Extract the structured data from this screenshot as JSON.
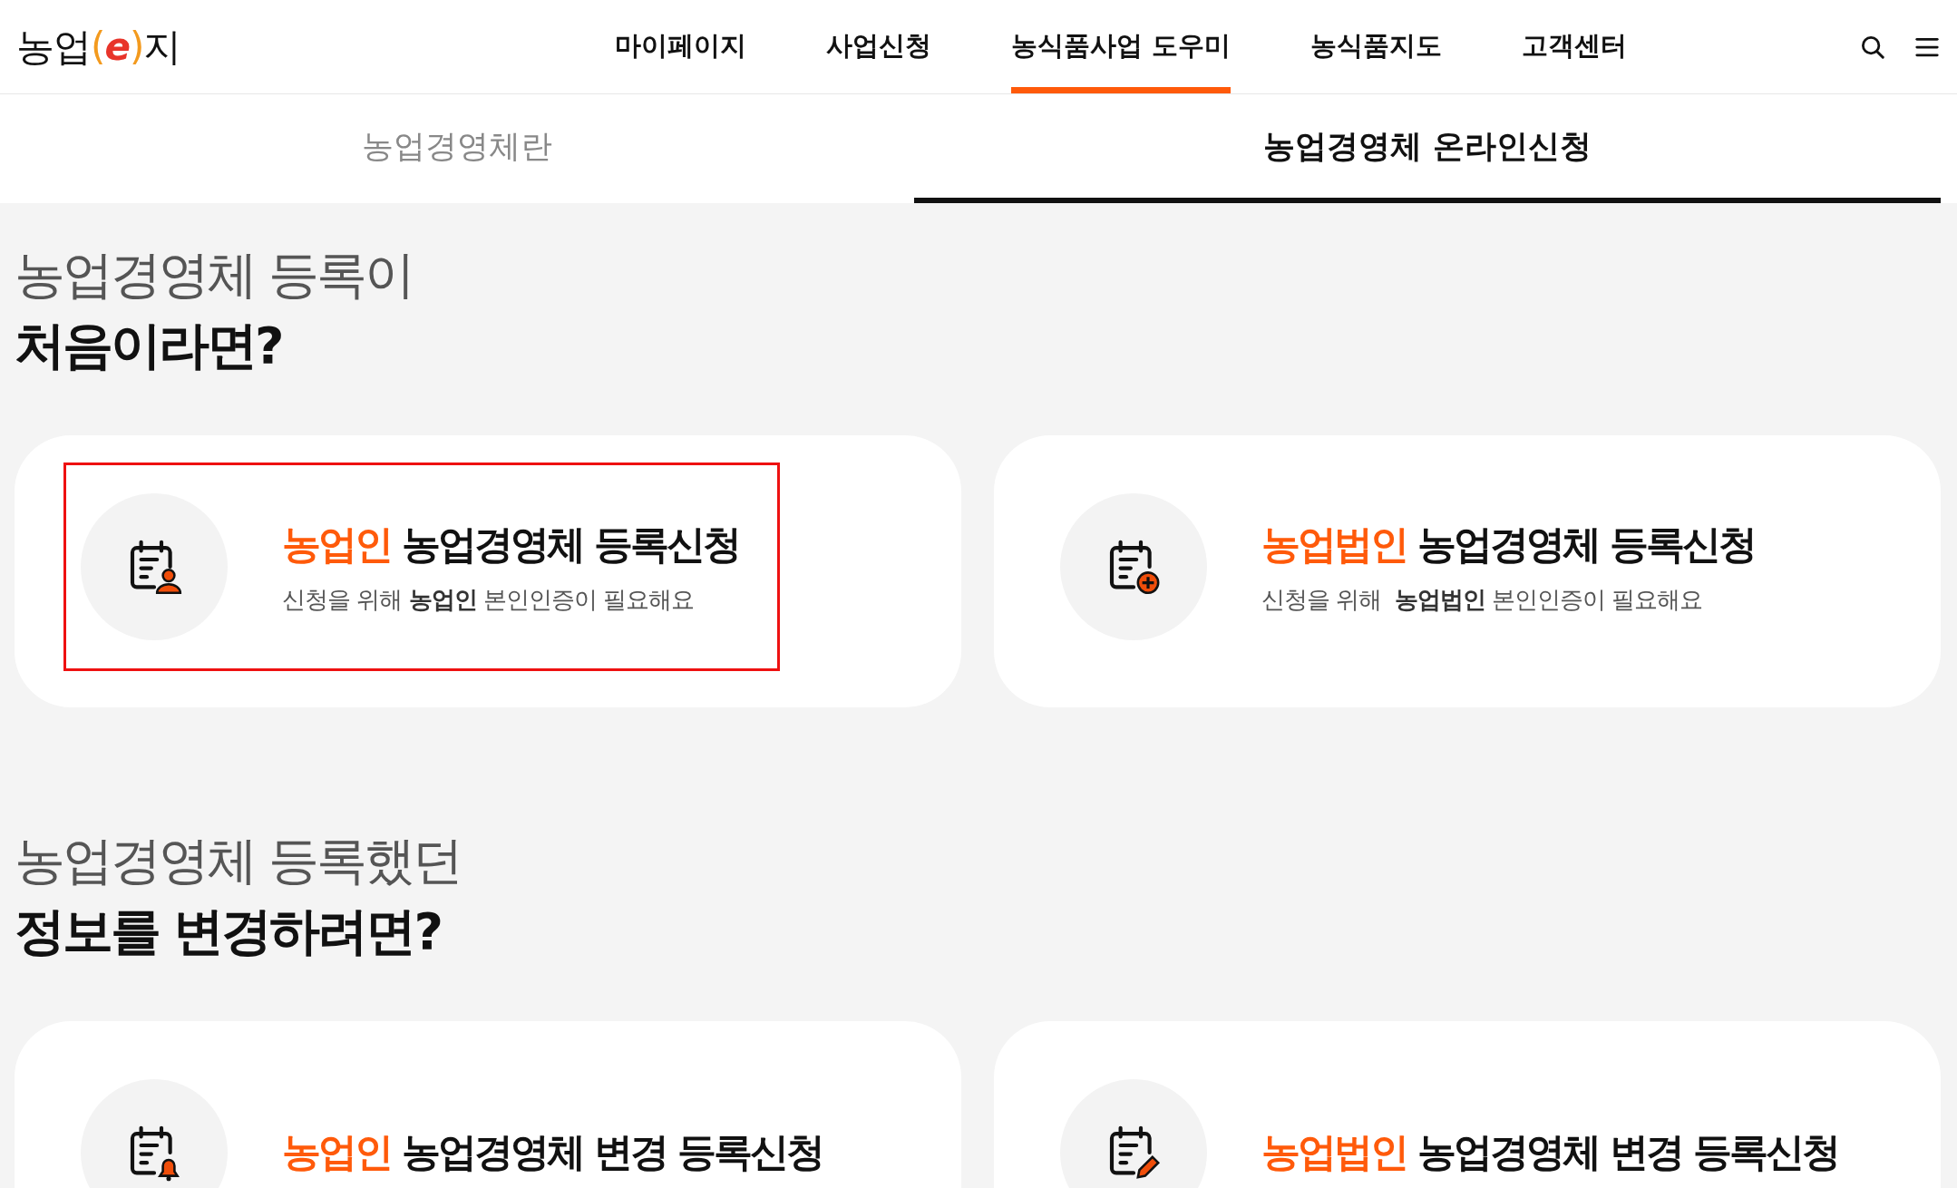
{
  "logo": [
    {
      "text": "농업",
      "kind": "plain"
    },
    {
      "text": "(",
      "kind": "bracket"
    },
    {
      "text": "e",
      "kind": "mark"
    },
    {
      "text": ")",
      "kind": "bracket"
    },
    {
      "text": "지",
      "kind": "plain"
    }
  ],
  "nav": [
    {
      "label": "마이페이지",
      "selected": false
    },
    {
      "label": "사업신청",
      "selected": false
    },
    {
      "label": "농식품사업 도우미",
      "selected": true
    },
    {
      "label": "농식품지도",
      "selected": false
    },
    {
      "label": "고객센터",
      "selected": false
    }
  ],
  "tabs": [
    {
      "label": "농업경영체란",
      "selected": false
    },
    {
      "label": "농업경영체 온라인신청",
      "selected": true
    }
  ],
  "sections": [
    {
      "heading_light": "농업경영체 등록이",
      "heading_bold": "처음이라면?",
      "cards": [
        {
          "highlight": "농업인",
          "title": "농업경영체 등록신청",
          "subtitle": "신청을 위해 **농업인** 본인인증이 필요해요",
          "kind": "person",
          "highlighted": true
        },
        {
          "highlight": "농업법인",
          "title": "농업경영체 등록신청",
          "subtitle": "신청을 위해  **농업법인** 본인인증이 필요해요",
          "kind": "plus",
          "highlighted": false
        }
      ]
    },
    {
      "heading_light": "농업경영체 등록했던",
      "heading_bold": "정보를 변경하려면?",
      "cards": [
        {
          "highlight": "농업인",
          "title": "농업경영체 변경 등록신청",
          "kind": "bell",
          "highlighted": false
        },
        {
          "highlight": "농업법인",
          "title": "농업경영체 변경 등록신청",
          "kind": "pencil",
          "highlighted": false
        }
      ]
    }
  ]
}
